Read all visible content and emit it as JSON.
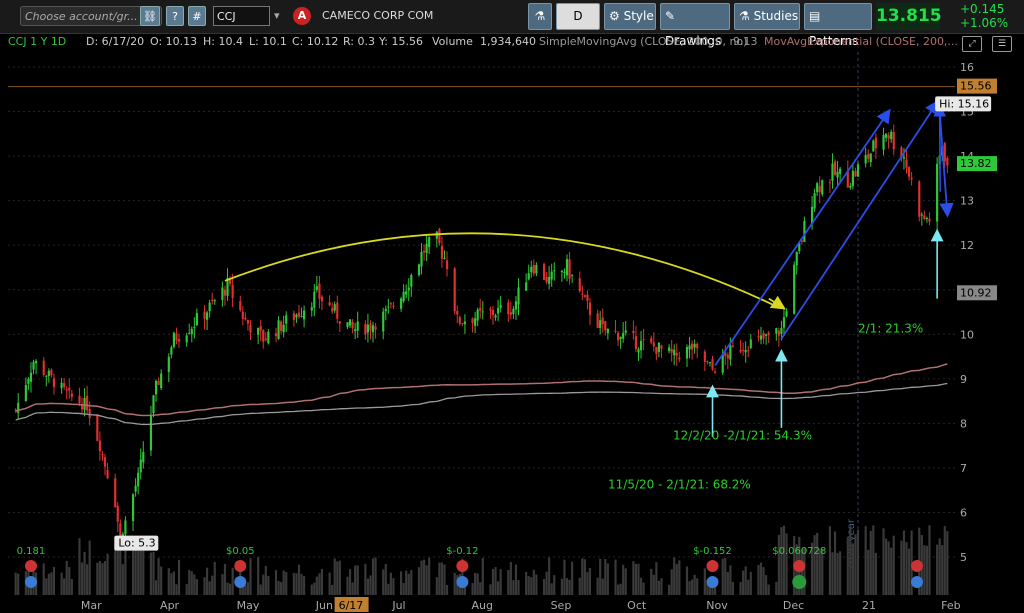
{
  "toolbar": {
    "account_placeholder": "Choose account/gr...",
    "symbol": "CCJ",
    "company": "CAMECO CORP COM",
    "period": "D",
    "style_label": "Style",
    "drawings_label": "Drawings",
    "studies_label": "Studies",
    "patterns_label": "Patterns",
    "last_price": "13.815",
    "change_abs": "+0.145",
    "change_pct": "+1.06%",
    "alert_letter": "A",
    "question_label": "?",
    "hash_label": "#"
  },
  "infobar": {
    "symbol_desc": "CCJ 1 Y 1D",
    "date": "D: 6/17/20",
    "open": "O: 10.13",
    "high": "H: 10.4",
    "low": "L: 10.1",
    "close": "C: 10.12",
    "range": "R: 0.3",
    "year": "Y: 15.56",
    "volume_label": "Volume",
    "volume_value": "1,934,640",
    "sma_label": "SimpleMovingAvg (CLOSE, 200, 0, no)",
    "sma_value": "9.13",
    "ema_label": "MovAvgExponential (CLOSE, 200,..."
  },
  "colors": {
    "up": "#2fc83a",
    "down": "#e03030",
    "sma": "#9a9a9a",
    "ema": "#b07070",
    "arc": "#d8d820",
    "arrow": "#2c4ee8",
    "cyan_arrow": "#7de8f0",
    "annotation": "#28d028",
    "volume": "#3a3a3a"
  },
  "chart_data": {
    "type": "candlestick",
    "x_labels": [
      "Mar",
      "Apr",
      "May",
      "Jun",
      "Jul",
      "Aug",
      "Sep",
      "Oct",
      "Nov",
      "Dec",
      "21",
      "Feb"
    ],
    "y_ticks": [
      5,
      6,
      7,
      8,
      9,
      10,
      11,
      12,
      13,
      14,
      15,
      16
    ],
    "ylim": [
      4.5,
      16.5
    ],
    "price_tags": {
      "high_line": "15.56",
      "last": "13.82",
      "ma": "10.92"
    },
    "hi_label": "Hi: 15.16",
    "lo_label": "Lo: 5.3",
    "cursor_date_label": "6/17",
    "year_marker_label": "2020 year",
    "anchors": [
      [
        "2020-02-06",
        8.3
      ],
      [
        "2020-02-13",
        9.4
      ],
      [
        "2020-02-20",
        9.0
      ],
      [
        "2020-02-27",
        8.6
      ],
      [
        "2020-03-05",
        8.4
      ],
      [
        "2020-03-10",
        7.5
      ],
      [
        "2020-03-16",
        6.2
      ],
      [
        "2020-03-18",
        5.4
      ],
      [
        "2020-03-25",
        6.8
      ],
      [
        "2020-04-01",
        8.8
      ],
      [
        "2020-04-08",
        9.9
      ],
      [
        "2020-04-15",
        10.2
      ],
      [
        "2020-04-22",
        10.6
      ],
      [
        "2020-04-29",
        11.1
      ],
      [
        "2020-05-06",
        10.3
      ],
      [
        "2020-05-13",
        9.9
      ],
      [
        "2020-05-20",
        10.2
      ],
      [
        "2020-05-27",
        10.5
      ],
      [
        "2020-06-03",
        10.9
      ],
      [
        "2020-06-10",
        10.5
      ],
      [
        "2020-06-17",
        10.1
      ],
      [
        "2020-06-24",
        10.2
      ],
      [
        "2020-07-01",
        10.5
      ],
      [
        "2020-07-08",
        11.1
      ],
      [
        "2020-07-15",
        11.9
      ],
      [
        "2020-07-20",
        12.1
      ],
      [
        "2020-07-24",
        11.6
      ],
      [
        "2020-07-28",
        10.3
      ],
      [
        "2020-08-05",
        10.4
      ],
      [
        "2020-08-12",
        10.5
      ],
      [
        "2020-08-19",
        10.6
      ],
      [
        "2020-08-26",
        11.6
      ],
      [
        "2020-09-02",
        11.2
      ],
      [
        "2020-09-09",
        11.5
      ],
      [
        "2020-09-16",
        10.7
      ],
      [
        "2020-09-23",
        10.1
      ],
      [
        "2020-09-30",
        10.0
      ],
      [
        "2020-10-07",
        9.8
      ],
      [
        "2020-10-14",
        9.7
      ],
      [
        "2020-10-21",
        9.5
      ],
      [
        "2020-10-28",
        9.7
      ],
      [
        "2020-11-05",
        9.2
      ],
      [
        "2020-11-12",
        9.6
      ],
      [
        "2020-11-19",
        9.8
      ],
      [
        "2020-11-26",
        9.9
      ],
      [
        "2020-12-02",
        10.1
      ],
      [
        "2020-12-08",
        11.7
      ],
      [
        "2020-12-15",
        13.3
      ],
      [
        "2020-12-22",
        13.6
      ],
      [
        "2020-12-29",
        13.5
      ],
      [
        "2021-01-05",
        14.0
      ],
      [
        "2021-01-12",
        14.6
      ],
      [
        "2021-01-19",
        14.0
      ],
      [
        "2021-01-26",
        12.6
      ],
      [
        "2021-01-29",
        12.6
      ],
      [
        "2021-02-03",
        14.3
      ],
      [
        "2021-02-05",
        13.815
      ]
    ],
    "annotations": [
      {
        "text": "12/2/20 -2/1/21: 54.3%"
      },
      {
        "text": "11/5/20 - 2/1/21: 68.2%"
      },
      {
        "text": "2/1: 21.3%"
      }
    ],
    "eps_labels": [
      "0.181",
      "$0.05",
      "$-0.12",
      "$-0.152",
      "$0.060728"
    ]
  }
}
